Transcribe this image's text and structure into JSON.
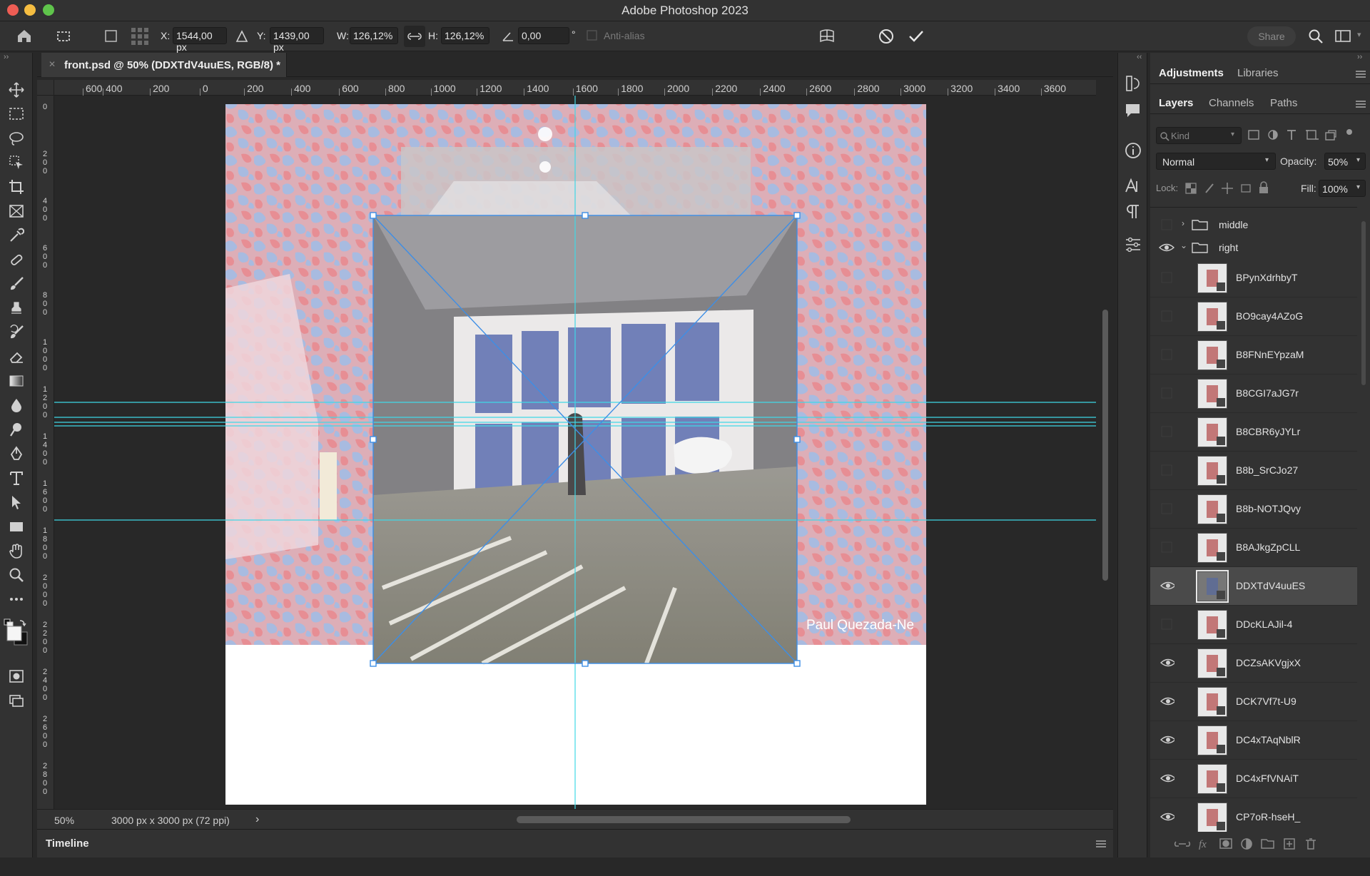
{
  "app": {
    "title": "Adobe Photoshop 2023"
  },
  "options": {
    "x_label": "X:",
    "x_value": "1544,00 px",
    "y_label": "Y:",
    "y_value": "1439,00 px",
    "w_label": "W:",
    "w_value": "126,12%",
    "h_label": "H:",
    "h_value": "126,12%",
    "angle_value": "0,00",
    "angle_unit": "°",
    "antialias_label": "Anti-alias",
    "share_label": "Share"
  },
  "document": {
    "tab_title": "front.psd @ 50% (DDXTdV4uuES, RGB/8) *"
  },
  "ruler": {
    "h_labels": [
      "600",
      "400",
      "200",
      "0",
      "200",
      "400",
      "600",
      "800",
      "1000",
      "1200",
      "1400",
      "1600",
      "1800",
      "2000",
      "2200",
      "2400",
      "2600",
      "2800",
      "3000",
      "3200",
      "3400",
      "3600"
    ],
    "v_labels": [
      "0",
      "200",
      "400",
      "600",
      "800",
      "1000",
      "1200",
      "1400",
      "1600",
      "1800",
      "2000",
      "2200",
      "2400",
      "2600",
      "2800"
    ]
  },
  "canvas": {
    "watermark_text": "Paul Quezada-Ne"
  },
  "status": {
    "zoom": "50%",
    "doc_info": "3000 px x 3000 px (72 ppi)",
    "arrow": "›"
  },
  "timeline": {
    "label": "Timeline"
  },
  "panels": {
    "top_tabs": [
      "Adjustments",
      "Libraries"
    ],
    "layer_tabs": [
      "Layers",
      "Channels",
      "Paths"
    ],
    "kind_placeholder": "Kind",
    "blend_mode": "Normal",
    "opacity_label": "Opacity:",
    "opacity_value": "50%",
    "lock_label": "Lock:",
    "fill_label": "Fill:",
    "fill_value": "100%"
  },
  "layers": {
    "groups": [
      {
        "name": "middle",
        "visible": false,
        "expanded": false
      },
      {
        "name": "right",
        "visible": true,
        "expanded": true
      }
    ],
    "items": [
      {
        "name": "BPynXdrhbyT",
        "visible": false
      },
      {
        "name": "BO9cay4AZoG",
        "visible": false
      },
      {
        "name": "B8FNnEYpzaM",
        "visible": false
      },
      {
        "name": "B8CGI7aJG7r",
        "visible": false
      },
      {
        "name": "B8CBR6yJYLr",
        "visible": false
      },
      {
        "name": "B8b_SrCJo27",
        "visible": false
      },
      {
        "name": "B8b-NOTJQvy",
        "visible": false
      },
      {
        "name": "B8AJkgZpCLL",
        "visible": false
      },
      {
        "name": "DDXTdV4uuES",
        "visible": true,
        "selected": true
      },
      {
        "name": "DDcKLAJil-4",
        "visible": false
      },
      {
        "name": "DCZsAKVgjxX",
        "visible": true
      },
      {
        "name": "DCK7Vf7t-U9",
        "visible": true
      },
      {
        "name": "DC4xTAqNblR",
        "visible": true
      },
      {
        "name": "DC4xFfVNAiT",
        "visible": true
      },
      {
        "name": "CP7oR-hseH_",
        "visible": true
      }
    ]
  }
}
